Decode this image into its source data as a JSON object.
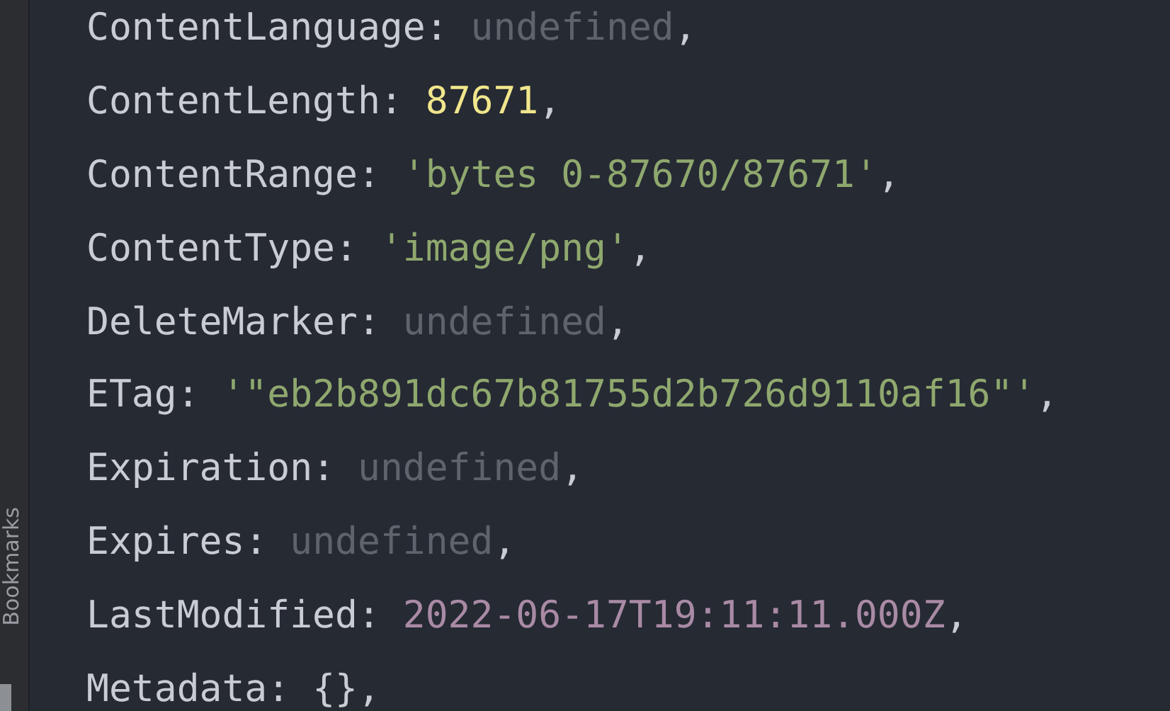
{
  "side_strip": {
    "label": "Bookmarks"
  },
  "lines": [
    {
      "key": "ContentLanguage",
      "colon": ":",
      "value": "undefined",
      "kind": "undefined",
      "comma": ","
    },
    {
      "key": "ContentLength",
      "colon": ":",
      "value": "87671",
      "kind": "number",
      "comma": ","
    },
    {
      "key": "ContentRange",
      "colon": ":",
      "value": "'bytes 0-87670/87671'",
      "kind": "string",
      "comma": ","
    },
    {
      "key": "ContentType",
      "colon": ":",
      "value": "'image/png'",
      "kind": "string",
      "comma": ","
    },
    {
      "key": "DeleteMarker",
      "colon": ":",
      "value": "undefined",
      "kind": "undefined",
      "comma": ","
    },
    {
      "key": "ETag",
      "colon": ":",
      "value": "'\"eb2b891dc67b81755d2b726d9110af16\"'",
      "kind": "string",
      "comma": ","
    },
    {
      "key": "Expiration",
      "colon": ":",
      "value": "undefined",
      "kind": "undefined",
      "comma": ","
    },
    {
      "key": "Expires",
      "colon": ":",
      "value": "undefined",
      "kind": "undefined",
      "comma": ","
    },
    {
      "key": "LastModified",
      "colon": ":",
      "value": "2022-06-17T19:11:11.000Z",
      "kind": "date",
      "comma": ","
    },
    {
      "key": "Metadata",
      "colon": ":",
      "value": "{}",
      "kind": "object",
      "comma": ","
    }
  ]
}
